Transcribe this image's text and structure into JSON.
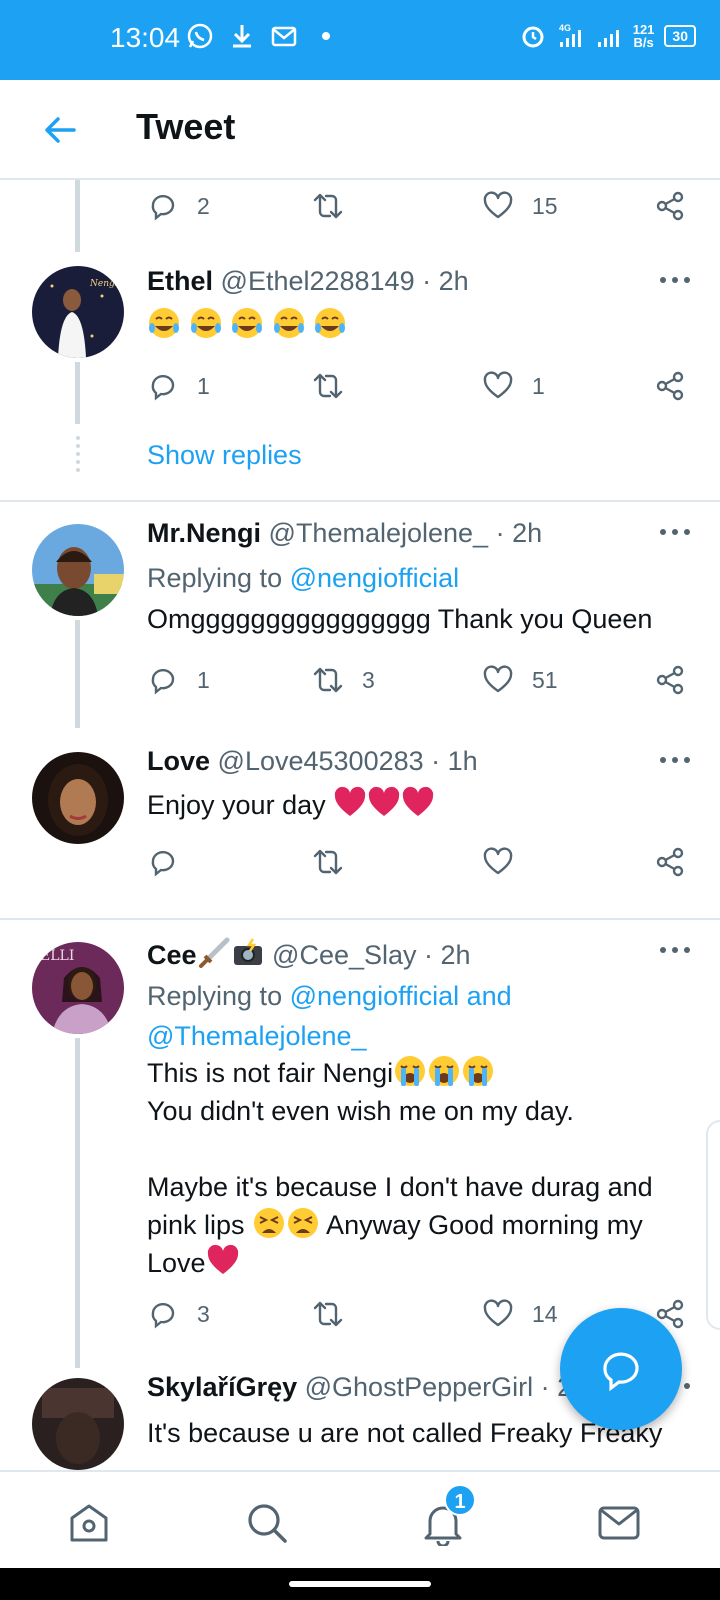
{
  "status_bar": {
    "time": "13:04",
    "network_type": "4G",
    "speed_value": "121",
    "speed_unit": "B/s",
    "battery": "30"
  },
  "header": {
    "title": "Tweet"
  },
  "top_tweet": {
    "replies": "2",
    "retweets": "",
    "likes": "15"
  },
  "tweets": [
    {
      "name": "Ethel",
      "handle": "@Ethel2288149",
      "sep": " · ",
      "time": "2h",
      "replies": "1",
      "retweets": "",
      "likes": "1"
    },
    {
      "name": "Mr.Nengi",
      "handle": "@Themalejolene_",
      "sep": " · ",
      "time": "2h",
      "replying_prefix": "Replying to ",
      "replying_to": "@nengiofficial",
      "text": "Omgggggggggggggggg Thank you Queen",
      "replies": "1",
      "retweets": "3",
      "likes": "51"
    },
    {
      "name": "Love",
      "handle": "@Love45300283",
      "sep": " · ",
      "time": "1h",
      "text": "Enjoy your day ",
      "replies": "",
      "retweets": "",
      "likes": ""
    },
    {
      "name": "Cee",
      "handle": "@Cee_Slay",
      "sep": " · ",
      "time": "2h",
      "replying_prefix": "Replying to ",
      "replying_to": "@nengiofficial and",
      "replying_to_2": "@Themalejolene_",
      "text_line1": "This is not fair Nengi",
      "text_line2": "You didn't even wish me on my day.",
      "text_line3": "Maybe it's because I don't have durag and",
      "text_line4_a": "pink lips ",
      "text_line4_b": " Anyway Good morning my",
      "text_line5": "Love",
      "replies": "3",
      "retweets": "",
      "likes": "14"
    },
    {
      "name": "SkylaříGręy",
      "handle": "@GhostPepperGirl",
      "sep": " · ",
      "time": "2h",
      "text": "It's because u are not called Freaky Freaky"
    }
  ],
  "show_replies": "Show replies",
  "bottom_nav": {
    "notifications_badge": "1"
  },
  "colors": {
    "brand": "#1da1f2",
    "heart": "#e0245e"
  }
}
